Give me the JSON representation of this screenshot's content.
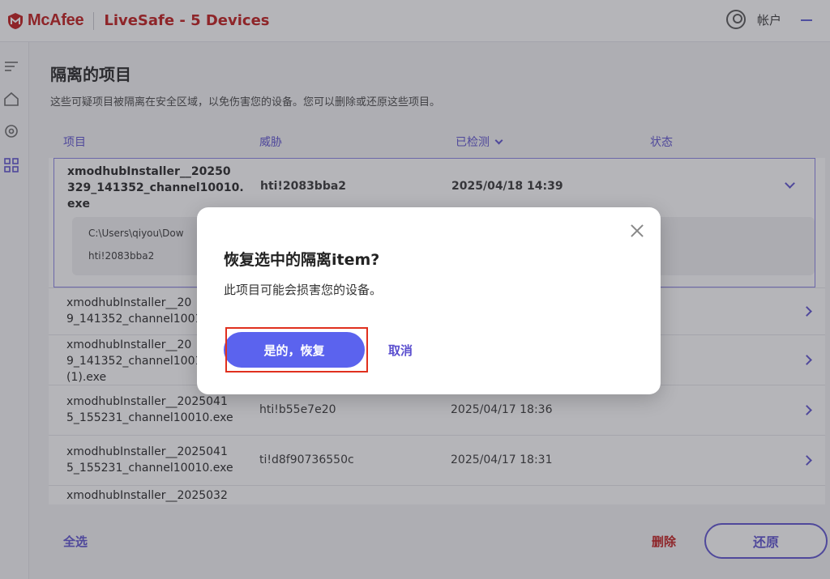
{
  "header": {
    "brand": "McAfee",
    "product": "LiveSafe - 5 Devices",
    "account_label": "帐户"
  },
  "page": {
    "title": "隔离的项目",
    "description": "这些可疑项目被隔离在安全区域，以免伤害您的设备。您可以删除或还原这些项目。"
  },
  "table": {
    "columns": [
      "项目",
      "威胁",
      "已检测",
      "状态"
    ],
    "expanded_row": {
      "name_lines": [
        "xmodhubInstaller__20250",
        "329_141352_channel10010.",
        "exe"
      ],
      "threat": "hti!2083bba2",
      "detected": "2025/04/18 14:39",
      "path": "C:\\Users\\qiyou\\Dow",
      "detail_threat": "hti!2083bba2"
    },
    "rows": [
      {
        "name_lines": [
          "xmodhubInstaller__20",
          "9_141352_channel1001"
        ],
        "threat": "",
        "detected": ""
      },
      {
        "name_lines": [
          "xmodhubInstaller__20",
          "9_141352_channel1001",
          "(1).exe"
        ],
        "threat": "",
        "detected": ""
      },
      {
        "name_lines": [
          "xmodhubInstaller__2025041",
          "5_155231_channel10010.exe"
        ],
        "threat": "hti!b55e7e20",
        "detected": "2025/04/17 18:36"
      },
      {
        "name_lines": [
          "xmodhubInstaller__2025041",
          "5_155231_channel10010.exe"
        ],
        "threat": "ti!d8f90736550c",
        "detected": "2025/04/17 18:31"
      },
      {
        "name_lines": [
          "xmodhubInstaller__2025032"
        ],
        "threat": "",
        "detected": ""
      }
    ]
  },
  "footer": {
    "select_all": "全选",
    "delete": "删除",
    "restore": "还原"
  },
  "dialog": {
    "title": "恢复选中的隔离item?",
    "body": "此项目可能会损害您的设备。",
    "confirm": "是的，恢复",
    "cancel": "取消"
  },
  "colors": {
    "brand_red": "#c01818",
    "accent_purple": "#5b4fcf",
    "confirm_button": "#5b63ee",
    "highlight_red": "#e0301e"
  }
}
